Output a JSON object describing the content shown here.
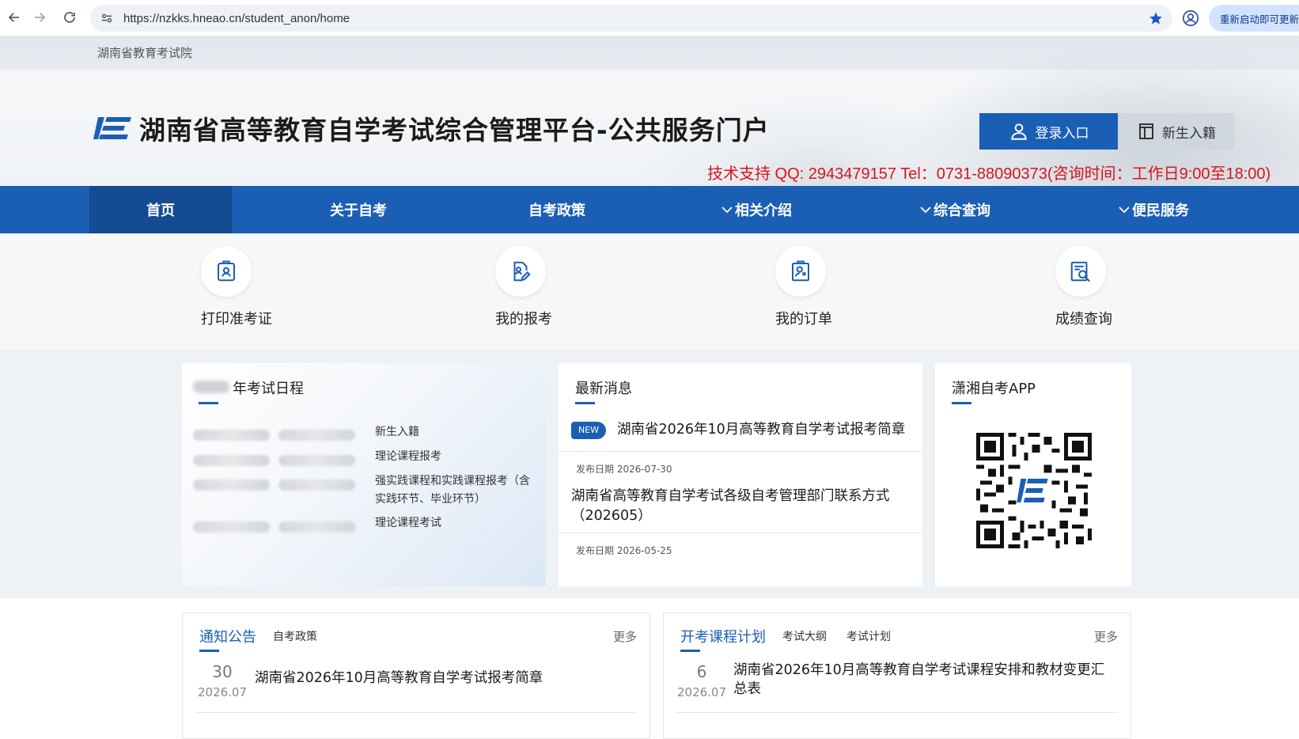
{
  "browser": {
    "url": "https://nzkks.hneao.cn/student_anon/home",
    "restart_label": "重新启动即可更新"
  },
  "header": {
    "org_name": "湖南省教育考试院",
    "site_title": "湖南省高等教育自学考试综合管理平台-公共服务门户",
    "login_label": "登录入口",
    "enroll_label": "新生入籍",
    "support_text": "技术支持 QQ: 2943479157 Tel：0731-88090373(咨询时间：工作日9:00至18:00)"
  },
  "nav": {
    "items": [
      {
        "label": "首页",
        "active": true,
        "has_menu": false
      },
      {
        "label": "关于自考",
        "active": false,
        "has_menu": false
      },
      {
        "label": "自考政策",
        "active": false,
        "has_menu": false
      },
      {
        "label": "相关介绍",
        "active": false,
        "has_menu": true
      },
      {
        "label": "综合查询",
        "active": false,
        "has_menu": true
      },
      {
        "label": "便民服务",
        "active": false,
        "has_menu": true
      }
    ]
  },
  "quick_actions": [
    {
      "label": "打印准考证",
      "icon": "id-badge-icon"
    },
    {
      "label": "我的报考",
      "icon": "edit-document-icon"
    },
    {
      "label": "我的订单",
      "icon": "clipboard-user-icon"
    },
    {
      "label": "成绩查询",
      "icon": "search-document-icon"
    }
  ],
  "schedule": {
    "title": "年考试日程",
    "events": [
      "新生入籍",
      "理论课程报考",
      "强实践课程和实践课程报考（含实践环节、毕业环节）",
      "理论课程考试"
    ]
  },
  "news": {
    "title": "最新消息",
    "badge": "NEW",
    "items": [
      {
        "title": "湖南省2026年10月高等教育自学考试报考简章",
        "date": "发布日期 2026-07-30"
      },
      {
        "title": "湖南省高等教育自学考试各级自考管理部门联系方式（202605）",
        "date": "发布日期 2026-05-25"
      }
    ]
  },
  "app": {
    "title": "潇湘自考APP"
  },
  "notice_panel": {
    "tab_active": "通知公告",
    "tab_other": "自考政策",
    "more": "更多",
    "item": {
      "day": "30",
      "ym": "2026.07",
      "title": "湖南省2026年10月高等教育自学考试报考简章"
    }
  },
  "course_panel": {
    "tab_active": "开考课程计划",
    "tabs": [
      "考试大纲",
      "考试计划"
    ],
    "more": "更多",
    "item": {
      "day": "6",
      "ym": "2026.07",
      "title": "湖南省2026年10月高等教育自学考试课程安排和教材变更汇总表"
    }
  },
  "colors": {
    "primary": "#1b5fb4",
    "primary_dark": "#154b92",
    "support_red": "#d8141c"
  }
}
